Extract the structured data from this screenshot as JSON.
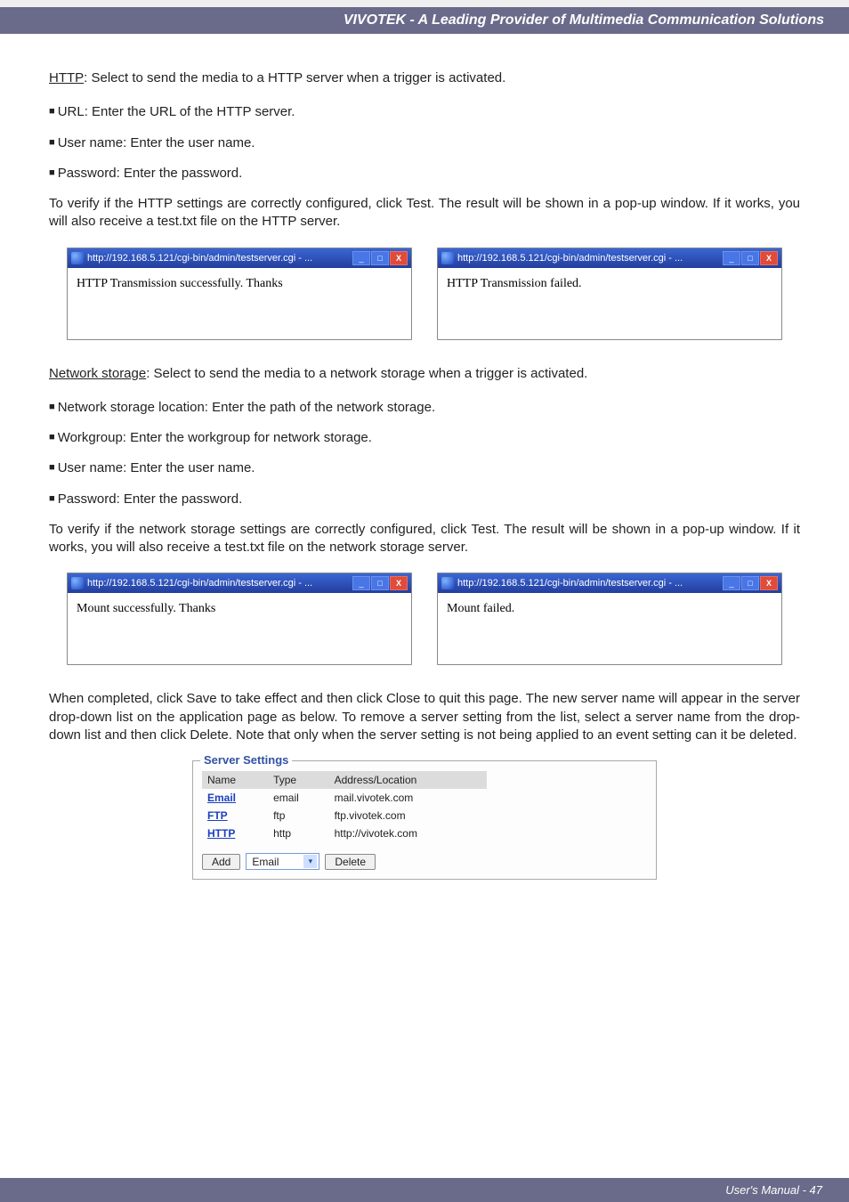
{
  "header": {
    "title": "VIVOTEK - A Leading Provider of Multimedia Communication Solutions"
  },
  "http_section": {
    "heading": "HTTP",
    "heading_rest": ": Select to send the media to a HTTP server when a trigger is activated.",
    "bullets": {
      "url": "URL: Enter the URL of the HTTP server.",
      "user": "User name: Enter the user name.",
      "pass": "Password: Enter the password."
    },
    "verify": "To verify if the HTTP settings are correctly configured, click Test. The result will be shown in a pop-up window. If it works, you will also receive a test.txt file on the HTTP server."
  },
  "popup_title": "http://192.168.5.121/cgi-bin/admin/testserver.cgi - ...",
  "popups": {
    "http_ok": "HTTP Transmission successfully. Thanks",
    "http_fail": "HTTP Transmission failed.",
    "mount_ok": "Mount successfully. Thanks",
    "mount_fail": "Mount failed."
  },
  "ns_section": {
    "heading": "Network storage",
    "heading_rest": ": Select to send the media to a network storage when a trigger is activated.",
    "bullets": {
      "loc": "Network storage location: Enter the path of the network storage.",
      "wg": "Workgroup: Enter the workgroup for network storage.",
      "user": "User name: Enter the user name.",
      "pass": "Password: Enter the password."
    },
    "verify": "To verify if the network storage settings are correctly configured, click Test. The result will be shown in a pop-up window. If it works, you will also receive a test.txt file on the network storage server."
  },
  "completed_para": "When completed, click Save to take effect and then click Close to quit this page. The new server name will appear in the server drop-down list on the application page as below. To remove a server setting from the list, select a server name from the drop-down list and then click Delete. Note that only when the server setting is not being applied to an event setting can it be deleted.",
  "server_panel": {
    "legend": "Server Settings",
    "headers": {
      "name": "Name",
      "type": "Type",
      "addr": "Address/Location"
    },
    "rows": [
      {
        "name": "Email",
        "type": "email",
        "addr": "mail.vivotek.com"
      },
      {
        "name": "FTP",
        "type": "ftp",
        "addr": "ftp.vivotek.com"
      },
      {
        "name": "HTTP",
        "type": "http",
        "addr": "http://vivotek.com"
      }
    ],
    "add_btn": "Add",
    "select_value": "Email",
    "delete_btn": "Delete"
  },
  "footer": {
    "text": "User's Manual - 47"
  },
  "winctrl": {
    "min": "_",
    "max": "□",
    "close": "X"
  }
}
